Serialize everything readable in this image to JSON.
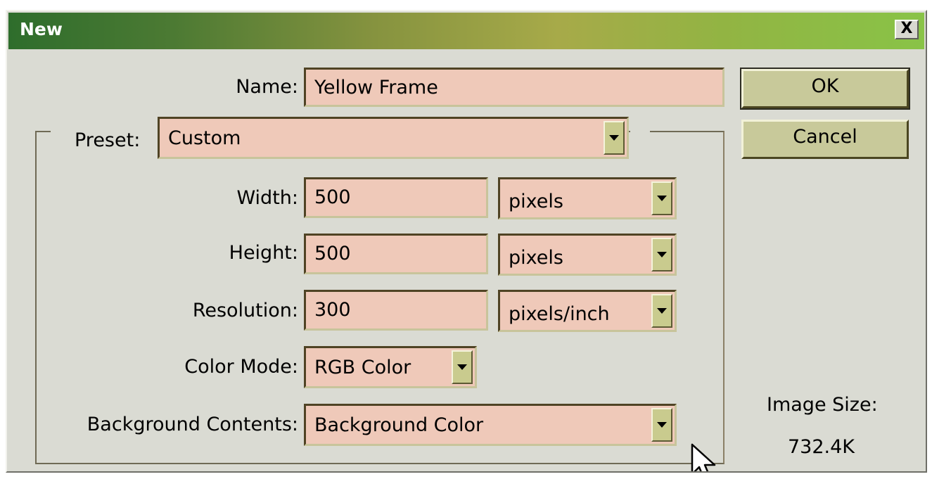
{
  "window": {
    "title": "New",
    "close_label": "X"
  },
  "form": {
    "name_label": "Name:",
    "name_value": "Yellow Frame",
    "preset_label": "Preset:",
    "preset_value": "Custom",
    "width_label": "Width:",
    "width_value": "500",
    "width_unit": "pixels",
    "height_label": "Height:",
    "height_value": "500",
    "height_unit": "pixels",
    "resolution_label": "Resolution:",
    "resolution_value": "300",
    "resolution_unit": "pixels/inch",
    "color_mode_label": "Color Mode:",
    "color_mode_value": "RGB Color",
    "background_label": "Background Contents:",
    "background_value": "Background Color"
  },
  "buttons": {
    "ok_label": "OK",
    "cancel_label": "Cancel"
  },
  "info": {
    "image_size_label": "Image Size:",
    "image_size_value": "732.4K"
  },
  "colors": {
    "field_background": "#efc9b9",
    "button_face": "#c8c99a",
    "dialog_background": "#dadbd3",
    "titlebar_start": "#2e6d2c",
    "titlebar_end": "#89c347"
  },
  "icons": {
    "close": "close-icon",
    "dropdown": "chevron-down-icon",
    "cursor": "mouse-pointer-icon"
  }
}
